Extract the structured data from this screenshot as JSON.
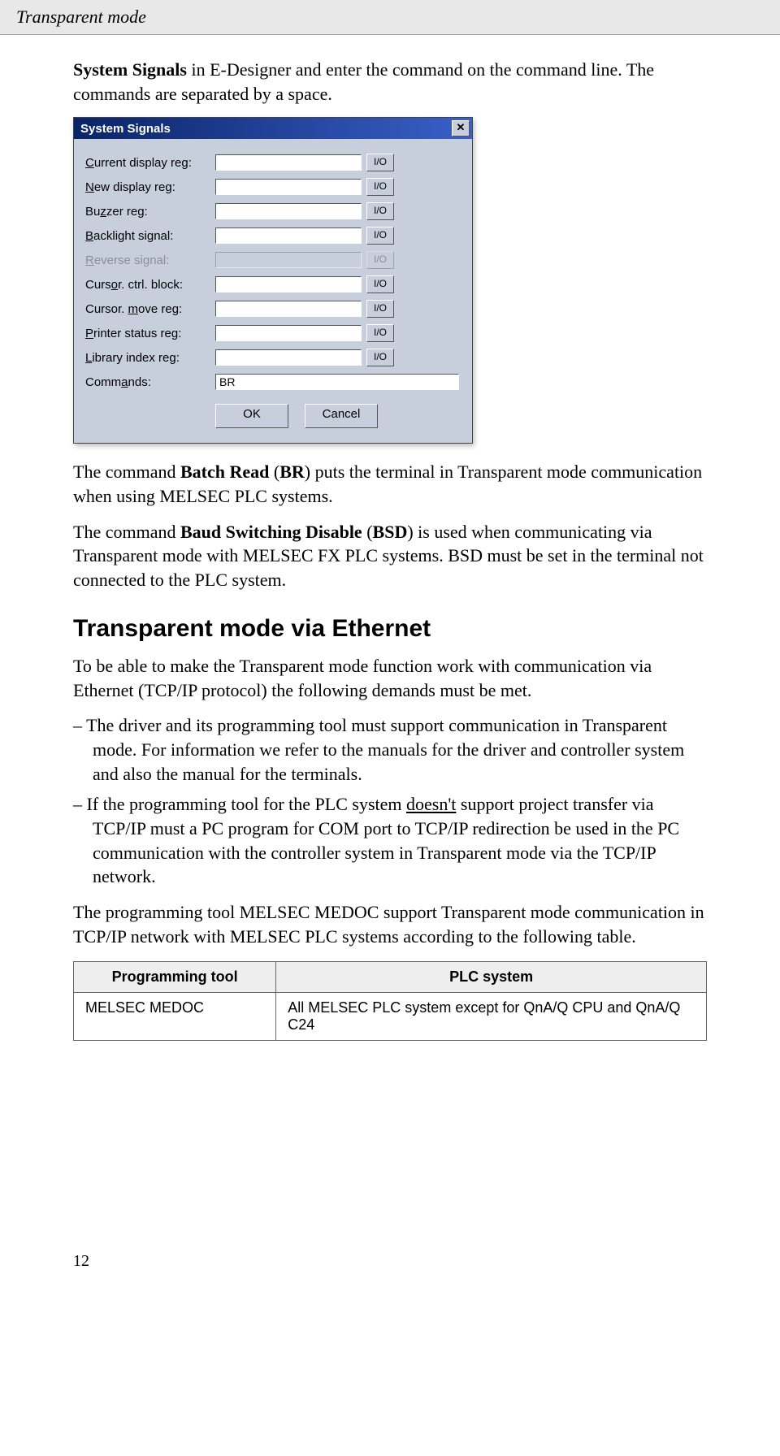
{
  "header": {
    "title": "Transparent mode"
  },
  "intro": "System Signals in E-Designer and enter the command on the command line. The commands are separated by a space.",
  "dialog": {
    "title": "System Signals",
    "close": "✕",
    "io": "I/O",
    "rows": [
      {
        "label_pre": "",
        "mn": "C",
        "label_post": "urrent display reg:",
        "disabled": false,
        "value": "",
        "io": true
      },
      {
        "label_pre": "",
        "mn": "N",
        "label_post": "ew display reg:",
        "disabled": false,
        "value": "",
        "io": true
      },
      {
        "label_pre": "Bu",
        "mn": "z",
        "label_post": "zer reg:",
        "disabled": false,
        "value": "",
        "io": true
      },
      {
        "label_pre": "",
        "mn": "B",
        "label_post": "acklight signal:",
        "disabled": false,
        "value": "",
        "io": true
      },
      {
        "label_pre": "",
        "mn": "R",
        "label_post": "everse signal:",
        "disabled": true,
        "value": "",
        "io": true
      },
      {
        "label_pre": "Curs",
        "mn": "o",
        "label_post": "r. ctrl. block:",
        "disabled": false,
        "value": "",
        "io": true
      },
      {
        "label_pre": "Cursor. ",
        "mn": "m",
        "label_post": "ove reg:",
        "disabled": false,
        "value": "",
        "io": true
      },
      {
        "label_pre": "",
        "mn": "P",
        "label_post": "rinter status reg:",
        "disabled": false,
        "value": "",
        "io": true
      },
      {
        "label_pre": "",
        "mn": "L",
        "label_post": "ibrary index reg:",
        "disabled": false,
        "value": "",
        "io": true
      },
      {
        "label_pre": "Comm",
        "mn": "a",
        "label_post": "nds:",
        "disabled": false,
        "value": "BR",
        "io": false,
        "wide": true
      }
    ],
    "ok": "OK",
    "cancel": "Cancel"
  },
  "para_br_1": "The command ",
  "para_br_bold": "Batch Read",
  "para_br_2": " (",
  "para_br_bold2": "BR",
  "para_br_3": ") puts the terminal in Transparent mode communication when using MELSEC PLC systems.",
  "para_bsd_1": "The command ",
  "para_bsd_bold": "Baud Switching Disable",
  "para_bsd_2": " (",
  "para_bsd_bold2": "BSD",
  "para_bsd_3": ") is used when communicating via Transparent mode with MELSEC FX PLC systems. BSD must be set in the terminal not connected to the PLC system.",
  "h2": "Transparent mode via Ethernet",
  "eth_intro": "To be able to make the Transparent mode function work with communication via Ethernet (TCP/IP protocol) the following demands must be met.",
  "bullets": [
    "The driver and its programming tool must support communication in Transparent mode. For information we refer to the manuals for the driver and controller system and also the manual for the terminals."
  ],
  "bullet2_pre": "If the programming tool for the PLC system ",
  "bullet2_u": "doesn't",
  "bullet2_post": " support project transfer via TCP/IP must a PC program for COM port to TCP/IP redirection be used in the PC communication with the controller system in Transparent mode via the TCP/IP network.",
  "para_medoc": "The programming tool MELSEC MEDOC support Transparent mode communication in TCP/IP network with MELSEC PLC systems according to the following table.",
  "table": {
    "headers": [
      "Programming tool",
      "PLC system"
    ],
    "rows": [
      [
        "MELSEC MEDOC",
        "All MELSEC PLC system except for QnA/Q CPU and QnA/Q C24"
      ]
    ]
  },
  "pagenum": "12"
}
